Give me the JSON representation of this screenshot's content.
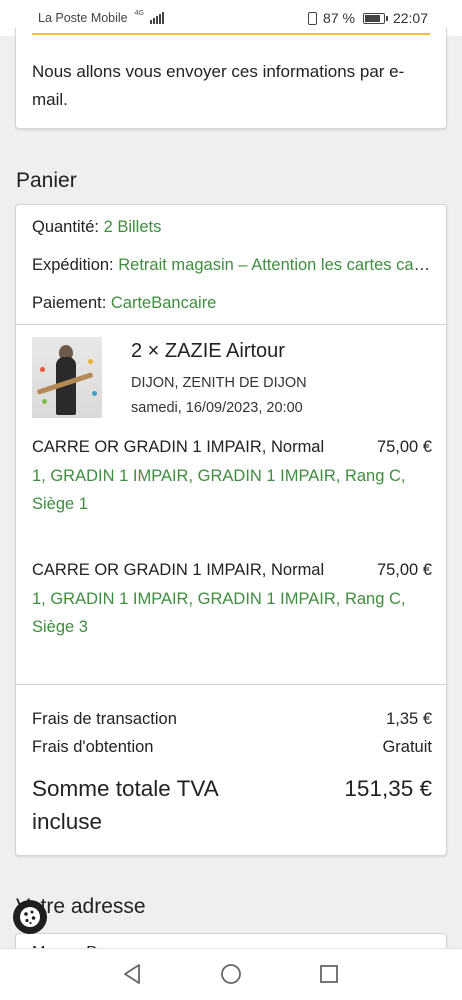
{
  "status_bar": {
    "carrier": "La Poste Mobile",
    "network": "4G",
    "battery": "87 %",
    "battery_level": 0.87,
    "time": "22:07"
  },
  "info_card": {
    "message": "Nous allons vous envoyer ces informations par e-mail."
  },
  "cart": {
    "title": "Panier",
    "quantity_label": "Quantité:",
    "quantity_value": "2 Billets",
    "shipping_label": "Expédition:",
    "shipping_value": "Retrait magasin – Attention les cartes cadeaux",
    "payment_label": "Paiement:",
    "payment_value": "CarteBancaire",
    "event": {
      "title": "2 × ZAZIE Airtour",
      "venue": "DIJON, ZENITH DE DIJON",
      "date": "samedi, 16/09/2023, 20:00"
    },
    "tickets": [
      {
        "category": "CARRE OR GRADIN 1 IMPAIR, Normal",
        "price": "75,00 €",
        "seat": "1, GRADIN 1 IMPAIR, GRADIN 1 IMPAIR, Rang C, Siège 1"
      },
      {
        "category": "CARRE OR GRADIN 1 IMPAIR, Normal",
        "price": "75,00 €",
        "seat": "1, GRADIN 1 IMPAIR, GRADIN 1 IMPAIR, Rang C, Siège 3"
      }
    ],
    "fees": [
      {
        "label": "Frais de transaction",
        "value": "1,35 €"
      },
      {
        "label": "Frais d'obtention",
        "value": "Gratuit"
      }
    ],
    "total_label": "Somme totale TVA incluse",
    "total_value": "151,35 €"
  },
  "address": {
    "title": "Votre adresse",
    "partial_text": "M... ...r D..."
  },
  "colors": {
    "accent_green": "#3f8d3f",
    "accent_yellow": "#f2c030"
  }
}
